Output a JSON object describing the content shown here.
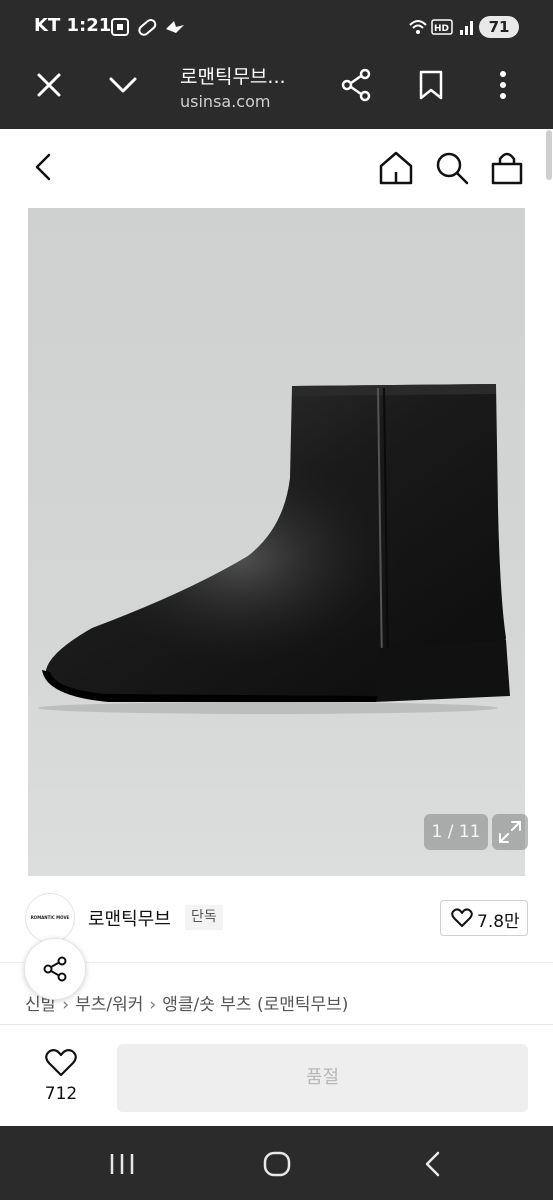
{
  "status_bar": {
    "carrier_time": "KT 1:21",
    "battery": "71"
  },
  "browser": {
    "title": "로맨틱무브...",
    "url": "usinsa.com"
  },
  "product": {
    "image_counter": "1 / 11",
    "brand_name": "로맨틱무브",
    "brand_logo_text": "ROMANTIC MOVE",
    "exclusive_badge": "단독",
    "like_count": "7.8만",
    "category": [
      "신발",
      "부츠/워커",
      "앵클/숏 부츠 (로맨틱무브)"
    ]
  },
  "bottom_bar": {
    "wish_count": "712",
    "soldout_label": "품절"
  },
  "colors": {
    "system_bar": "#2b2b2b",
    "soldout_bg": "#eeeeee",
    "soldout_text": "#b8b8b8"
  }
}
